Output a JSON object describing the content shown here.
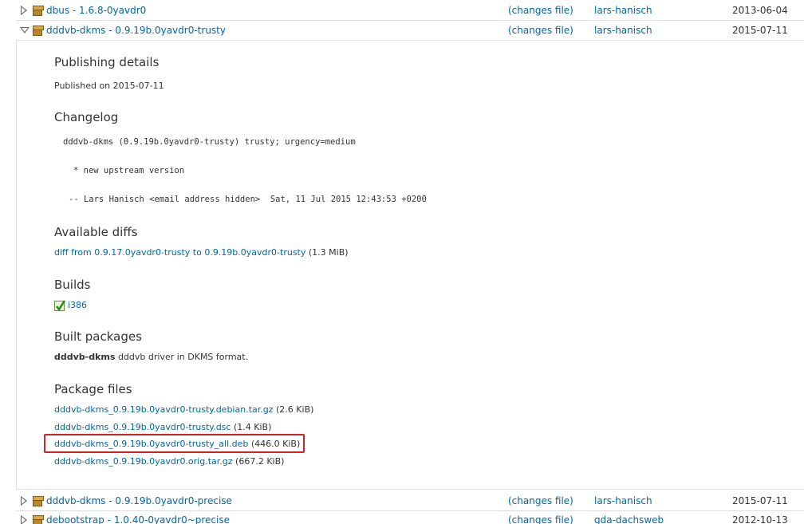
{
  "rows": [
    {
      "name": "dbus - 1.6.8-0yavdr0",
      "changes": "(changes file)",
      "uploader": "lars-hanisch",
      "date": "2013-06-04",
      "expanded": false
    },
    {
      "name": "dddvb-dkms - 0.9.19b.0yavdr0-trusty",
      "changes": "(changes file)",
      "uploader": "lars-hanisch",
      "date": "2015-07-11",
      "expanded": true
    },
    {
      "name": "dddvb-dkms - 0.9.19b.0yavdr0-precise",
      "changes": "(changes file)",
      "uploader": "lars-hanisch",
      "date": "2015-07-11",
      "expanded": false
    },
    {
      "name": "debootstrap - 1.0.40-0yavdr0~precise",
      "changes": "(changes file)",
      "uploader": "gda-dachsweb",
      "date": "2012-10-13",
      "expanded": false
    }
  ],
  "details": {
    "publishing_heading": "Publishing details",
    "published_on": "Published on 2015-07-11",
    "changelog_heading": "Changelog",
    "changelog_lines": [
      "dddvb-dkms (0.9.19b.0yavdr0-trusty) trusty; urgency=medium",
      "* new upstream version",
      "-- Lars Hanisch <email address hidden>  Sat, 11 Jul 2015 12:43:53 +0200"
    ],
    "diffs_heading": "Available diffs",
    "diff_link": "diff from 0.9.17.0yavdr0-trusty to 0.9.19b.0yavdr0-trusty",
    "diff_size": "(1.3 MiB)",
    "builds_heading": "Builds",
    "build_arch": "i386",
    "built_heading": "Built packages",
    "built_pkg_name": "dddvb-dkms",
    "built_pkg_desc": "dddvb driver in DKMS format.",
    "files_heading": "Package files",
    "files": [
      {
        "name": "dddvb-dkms_0.9.19b.0yavdr0-trusty.debian.tar.gz",
        "size": "(2.6 KiB)"
      },
      {
        "name": "dddvb-dkms_0.9.19b.0yavdr0-trusty.dsc",
        "size": "(1.4 KiB)"
      },
      {
        "name": "dddvb-dkms_0.9.19b.0yavdr0-trusty_all.deb",
        "size": "(446.0 KiB)"
      },
      {
        "name": "dddvb-dkms_0.9.19b.0yavdr0.orig.tar.gz",
        "size": "(667.2 KiB)"
      }
    ]
  },
  "colors": {
    "link": "#0066aa",
    "highlight": "#d32020"
  }
}
